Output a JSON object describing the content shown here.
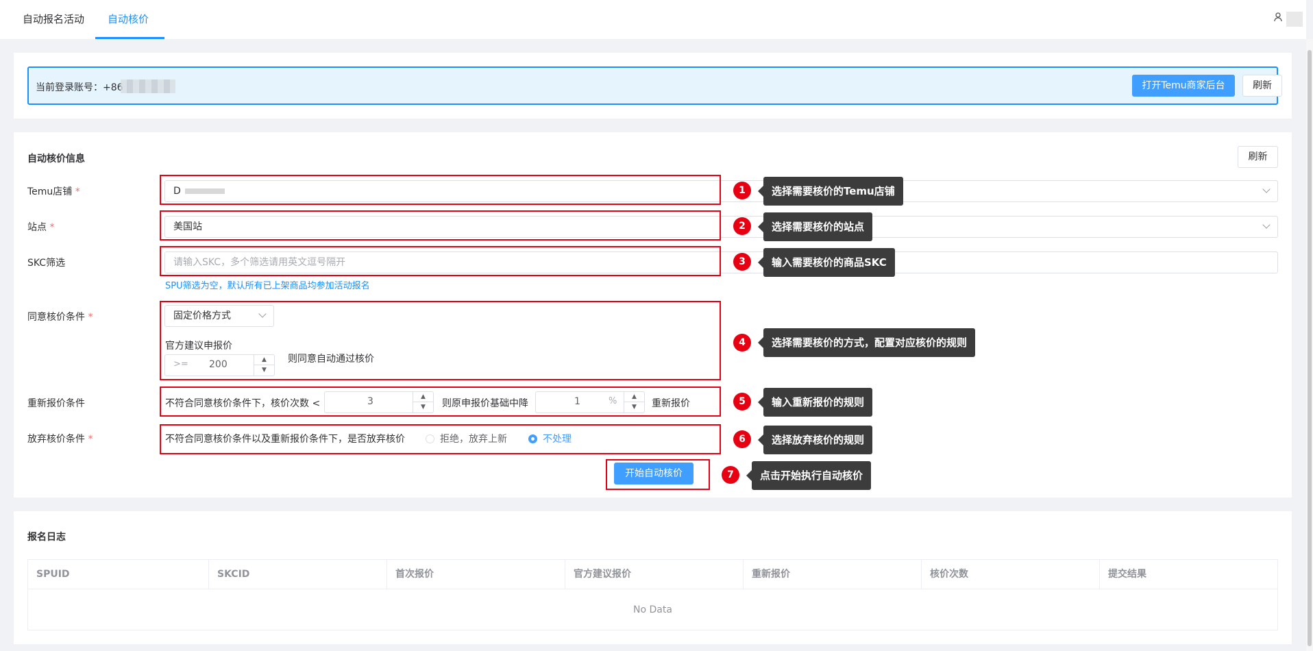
{
  "nav": {
    "tabs": [
      {
        "label": "自动报名活动"
      },
      {
        "label": "自动核价"
      }
    ],
    "active_tab": "自动核价",
    "user_icon": "user-icon"
  },
  "account": {
    "label": "当前登录账号：+86",
    "open_backend_label": "打开Temu商家后台",
    "refresh_label": "刷新"
  },
  "info": {
    "title": "自动核价信息",
    "refresh_label": "刷新",
    "store": {
      "label": "Temu店铺",
      "required": "*",
      "value": "D"
    },
    "site": {
      "label": "站点",
      "required": "*",
      "value": "美国站"
    },
    "skc": {
      "label": "SKC筛选",
      "placeholder": "请输入SKC，多个筛选请用英文逗号隔开",
      "hint": "SPU筛选为空，默认所有已上架商品均参加活动报名"
    },
    "agree": {
      "label": "同意核价条件",
      "required": "*",
      "method": "固定价格方式",
      "sub_label": "官方建议申报价",
      "operator": ">=",
      "value": "200",
      "after_text": "则同意自动通过核价"
    },
    "reprice": {
      "label": "重新报价条件",
      "prefix_text": "不符合同意核价条件下，核价次数 <",
      "count": "3",
      "middle_text": "则原申报价基础中降",
      "percent": "1",
      "percent_unit": "%",
      "suffix_text": "重新报价"
    },
    "abandon": {
      "label": "放弃核价条件",
      "required": "*",
      "question": "不符合同意核价条件以及重新报价条件下，是否放弃核价",
      "options": [
        {
          "label": "拒绝，放弃上新",
          "checked": false
        },
        {
          "label": "不处理",
          "checked": true
        }
      ]
    },
    "start_label": "开始自动核价"
  },
  "annotations": [
    {
      "num": "1",
      "text": "选择需要核价的Temu店铺"
    },
    {
      "num": "2",
      "text": "选择需要核价的站点"
    },
    {
      "num": "3",
      "text": "输入需要核价的商品SKC"
    },
    {
      "num": "4",
      "text": "选择需要核价的方式，配置对应核价的规则"
    },
    {
      "num": "5",
      "text": "输入重新报价的规则"
    },
    {
      "num": "6",
      "text": "选择放弃核价的规则"
    },
    {
      "num": "7",
      "text": "点击开始执行自动核价"
    }
  ],
  "log": {
    "title": "报名日志",
    "columns": [
      "SPUID",
      "SKCID",
      "首次报价",
      "官方建议报价",
      "重新报价",
      "核价次数",
      "提交结果"
    ],
    "empty_text": "No Data"
  }
}
